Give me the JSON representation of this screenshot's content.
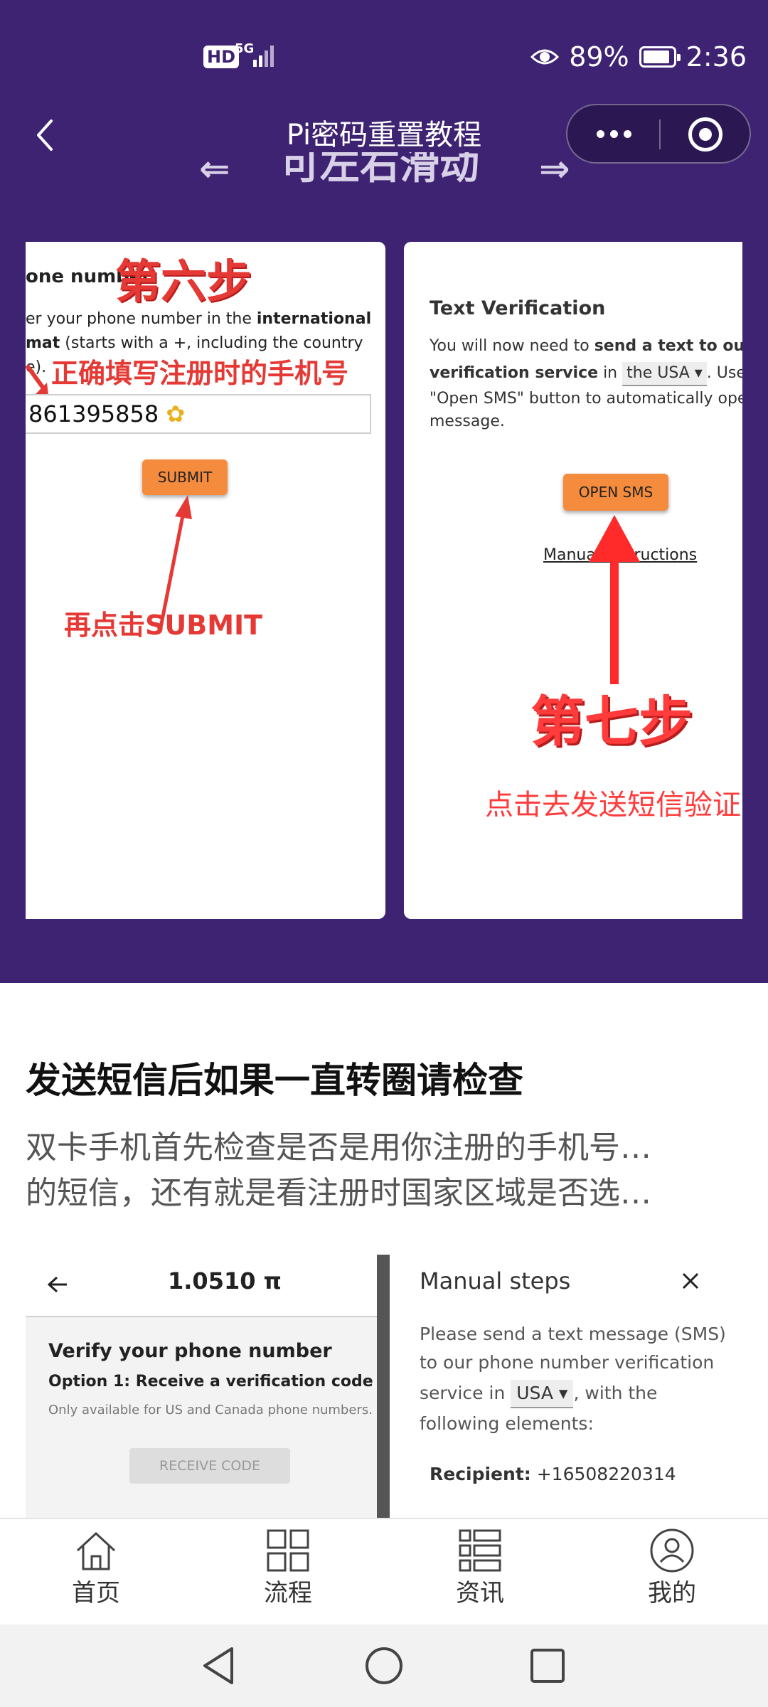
{
  "status_bar": {
    "hd": "HD",
    "network": "5G",
    "battery": "89%",
    "time": "2:36"
  },
  "header": {
    "title": "Pi密码重置教程",
    "swipe_hint": "可左右滑动"
  },
  "slide_left": {
    "heading": "one number",
    "step_label": "第六步",
    "instruction_text": "er your phone number in the",
    "instruction_bold": "international",
    "line2_bold": "mat",
    "line2_text": "(starts with a +, including the country",
    "line3_text": "e).",
    "red_note": "正确填写注册时的手机号",
    "phone_value": "861395858",
    "submit_label": "SUBMIT",
    "click_note": "再点击SUBMIT"
  },
  "slide_right": {
    "heading": "Text Verification",
    "line1_text": "You will now need to",
    "line1_bold": "send a text to our",
    "line2_bold": "verification service",
    "line2_in": "in",
    "country_select": "the USA",
    "line2_tail": ". Use",
    "line3_text": "\"Open SMS\" button to automatically open",
    "line4_text": "message.",
    "open_sms_label": "OPEN SMS",
    "manual_link": "Manual Instructions",
    "step_label": "第七步",
    "click_note": "点击去发送短信验证"
  },
  "article": {
    "title": "发送短信后如果一直转圈请检查",
    "body_line1": "双卡手机首先检查是否是用你注册的手机号…",
    "body_line2": "的短信，还有就是看注册时国家区域是否选…"
  },
  "lower_screenshot": {
    "balance": "1.0510 π",
    "verify_title": "Verify your phone number",
    "option1": "Option 1: Receive a verification code",
    "only_available": "Only available for US and Canada phone numbers.",
    "receive_code": "RECEIVE CODE",
    "manual_title": "Manual steps",
    "manual_text1": "Please send a text message (SMS)",
    "manual_text2": "to our phone number verification",
    "manual_text3_pre": "service in",
    "manual_country": "USA",
    "manual_text3_post": ", with the",
    "manual_text4": "following elements:",
    "recipient_label": "Recipient:",
    "recipient_value": "+16508220314"
  },
  "tabbar": {
    "items": [
      {
        "label": "首页"
      },
      {
        "label": "流程"
      },
      {
        "label": "资讯"
      },
      {
        "label": "我的"
      }
    ]
  },
  "colors": {
    "brand_purple": "#3f2373",
    "accent_red": "#e53935",
    "button_orange": "#f58b3c"
  }
}
